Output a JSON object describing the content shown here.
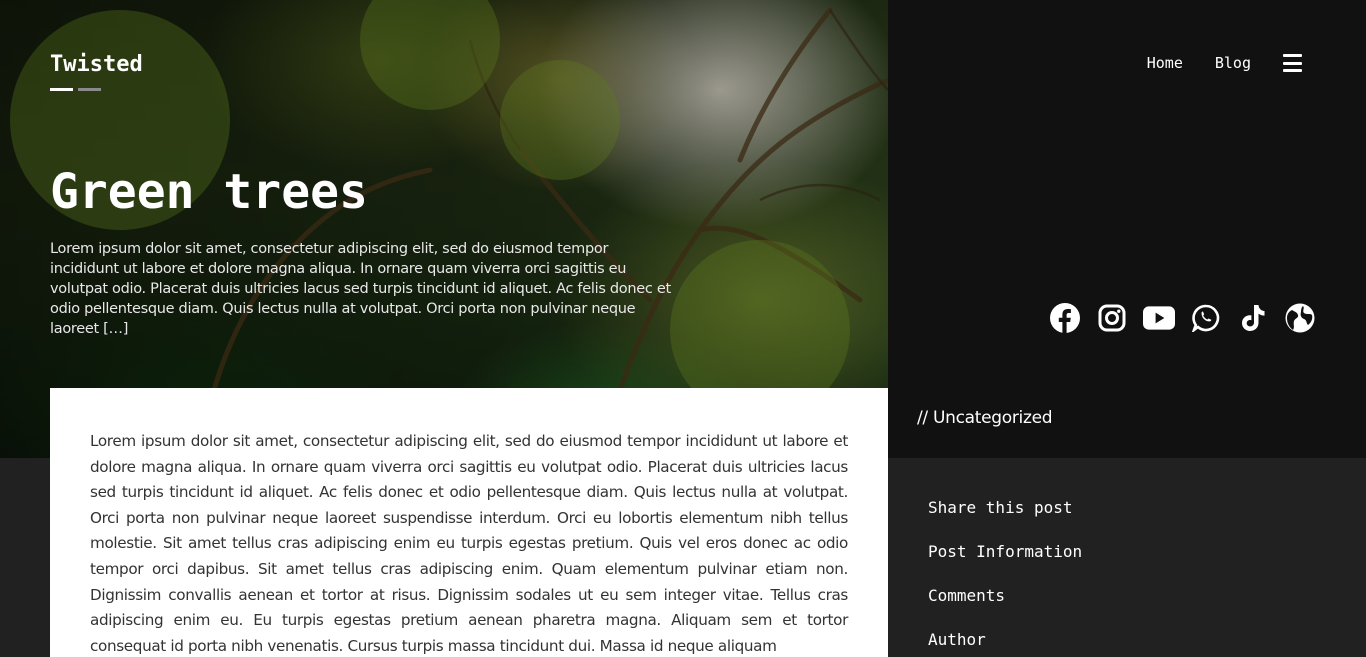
{
  "site": {
    "logo_text": "Twisted"
  },
  "nav": {
    "items": [
      {
        "label": "Home"
      },
      {
        "label": "Blog"
      }
    ],
    "menu_icon": "hamburger-menu-icon"
  },
  "hero": {
    "title": "Green trees",
    "excerpt": "Lorem ipsum dolor sit amet, consectetur adipiscing elit, sed do eiusmod tempor incididunt ut labore et dolore magna aliqua. In ornare quam viverra orci sagittis eu volutpat odio. Placerat duis ultricies lacus sed turpis tincidunt id aliquet. Ac felis donec et odio pellentesque diam. Quis lectus nulla at volutpat. Orci porta non pulvinar neque laoreet […]"
  },
  "socials": [
    {
      "icon": "facebook-icon"
    },
    {
      "icon": "instagram-icon"
    },
    {
      "icon": "youtube-icon"
    },
    {
      "icon": "whatsapp-icon"
    },
    {
      "icon": "tiktok-icon"
    },
    {
      "icon": "globe-icon"
    }
  ],
  "post": {
    "category": "// Uncategorized",
    "body": "Lorem ipsum dolor sit amet, consectetur adipiscing elit, sed do eiusmod tempor incididunt ut labore et dolore magna aliqua. In ornare quam viverra orci sagittis eu volutpat odio. Placerat duis ultricies lacus sed turpis tincidunt id aliquet. Ac felis donec et odio pellentesque diam. Quis lectus nulla at volutpat. Orci porta non pulvinar neque laoreet suspendisse interdum. Orci eu lobortis elementum nibh tellus molestie. Sit amet tellus cras adipiscing enim eu turpis egestas pretium. Quis vel eros donec ac odio tempor orci dapibus. Sit amet tellus cras adipiscing enim. Quam elementum pulvinar etiam non. Dignissim convallis aenean et tortor at risus. Dignissim sodales ut eu sem integer vitae. Tellus cras adipiscing enim eu. Eu turpis egestas pretium aenean pharetra magna. Aliquam sem et tortor consequat id porta nibh venenatis. Cursus turpis massa tincidunt dui. Massa id neque aliquam"
  },
  "sidebar": {
    "links": [
      {
        "label": "Share this post"
      },
      {
        "label": "Post Information"
      },
      {
        "label": "Comments"
      },
      {
        "label": "Author"
      }
    ]
  },
  "colors": {
    "page_bg": "#212121",
    "panel_bg": "#111111",
    "card_bg": "#ffffff",
    "text_light": "#ffffff",
    "text_dark": "#333333"
  }
}
